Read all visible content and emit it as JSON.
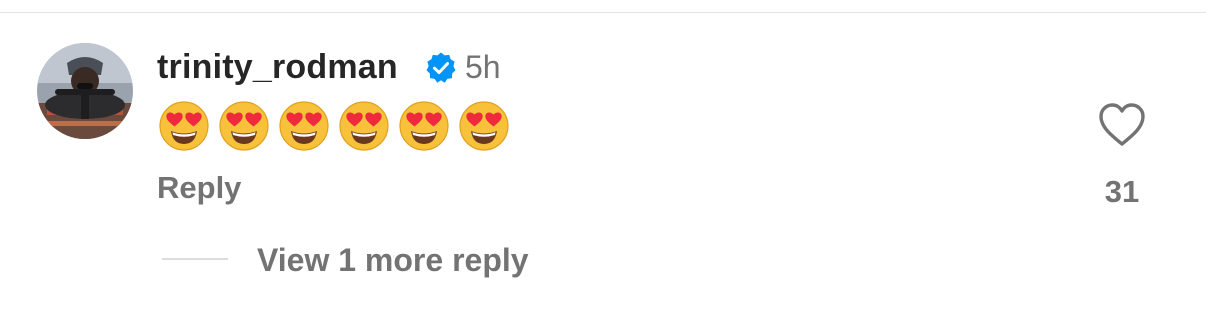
{
  "comment": {
    "username": "trinity_rodman",
    "verified": true,
    "timestamp": "5h",
    "emojis": [
      "heart-eyes",
      "heart-eyes",
      "heart-eyes",
      "heart-eyes",
      "heart-eyes",
      "heart-eyes"
    ],
    "reply_label": "Reply",
    "like_count": "31",
    "view_replies_label": "View 1 more reply"
  },
  "icons": {
    "verified": "verified-badge-icon",
    "like": "heart-outline-icon",
    "emoji": "smiling-face-with-heart-eyes-emoji"
  },
  "colors": {
    "username": "#262626",
    "secondary_text": "#737373",
    "verified_blue": "#0095f6",
    "divider": "#e3e4e6"
  }
}
